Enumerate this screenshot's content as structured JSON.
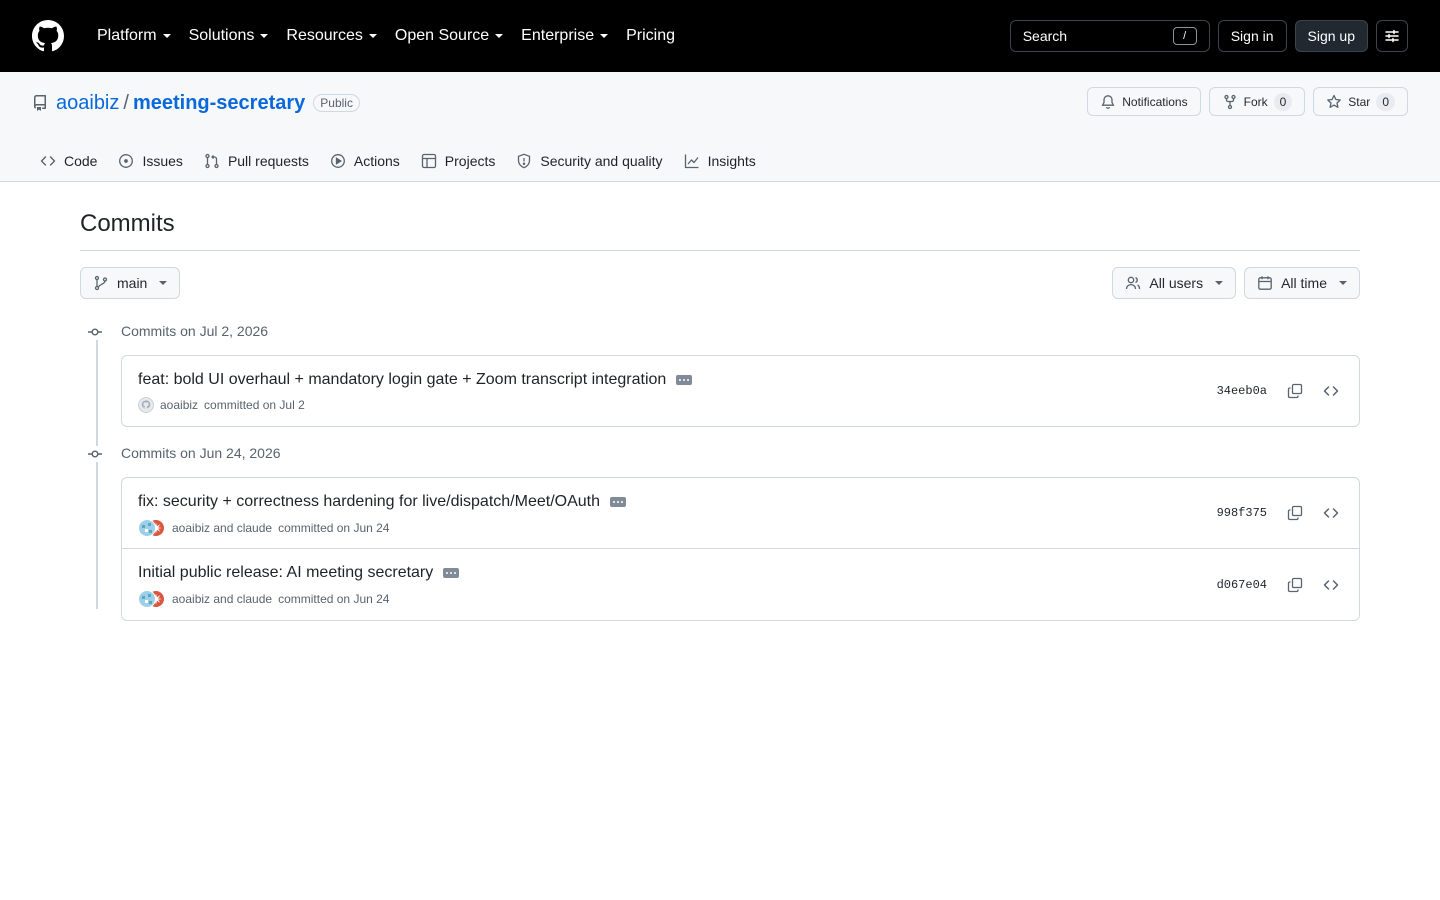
{
  "header": {
    "nav": [
      {
        "label": "Platform",
        "has_dropdown": true
      },
      {
        "label": "Solutions",
        "has_dropdown": true
      },
      {
        "label": "Resources",
        "has_dropdown": true
      },
      {
        "label": "Open Source",
        "has_dropdown": true
      },
      {
        "label": "Enterprise",
        "has_dropdown": true
      },
      {
        "label": "Pricing",
        "has_dropdown": false
      }
    ],
    "search_label": "Search",
    "search_shortcut": "/",
    "sign_in": "Sign in",
    "sign_up": "Sign up"
  },
  "repo": {
    "owner": "aoaibiz",
    "separator": "/",
    "name": "meeting-secretary",
    "visibility": "Public",
    "notifications_label": "Notifications",
    "fork_label": "Fork",
    "fork_count": "0",
    "star_label": "Star",
    "star_count": "0",
    "tabs": [
      {
        "label": "Code",
        "icon": "code-icon"
      },
      {
        "label": "Issues",
        "icon": "issue-icon"
      },
      {
        "label": "Pull requests",
        "icon": "pull-request-icon"
      },
      {
        "label": "Actions",
        "icon": "play-icon"
      },
      {
        "label": "Projects",
        "icon": "table-icon"
      },
      {
        "label": "Security and quality",
        "icon": "shield-icon"
      },
      {
        "label": "Insights",
        "icon": "graph-icon"
      }
    ]
  },
  "page": {
    "title": "Commits",
    "branch": "main",
    "users_filter": "All users",
    "time_filter": "All time"
  },
  "commit_groups": [
    {
      "heading": "Commits on Jul 2, 2026",
      "commits": [
        {
          "message": "feat: bold UI overhaul + mandatory login gate + Zoom transcript integration",
          "author_text": "aoaibiz",
          "committed_text": "committed on Jul 2",
          "sha": "34eeb0a",
          "coauthored": false
        }
      ]
    },
    {
      "heading": "Commits on Jun 24, 2026",
      "commits": [
        {
          "message": "fix: security + correctness hardening for live/dispatch/Meet/OAuth",
          "author_text": "aoaibiz and claude",
          "committed_text": "committed on Jun 24",
          "sha": "998f375",
          "coauthored": true
        },
        {
          "message": "Initial public release: AI meeting secretary",
          "author_text": "aoaibiz and claude",
          "committed_text": "committed on Jun 24",
          "sha": "d067e04",
          "coauthored": true
        }
      ]
    }
  ]
}
